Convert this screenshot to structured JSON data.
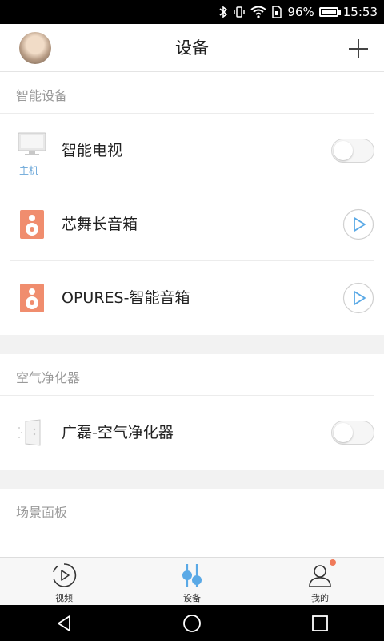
{
  "status_bar": {
    "battery": "96%",
    "time": "15:53"
  },
  "header": {
    "title": "设备"
  },
  "sections": [
    {
      "title": "智能设备",
      "items": [
        {
          "label": "智能电视",
          "sub": "主机",
          "control": "toggle",
          "on": false
        },
        {
          "label": "芯舞长音箱",
          "control": "play"
        },
        {
          "label": "OPURES-智能音箱",
          "control": "play"
        }
      ]
    },
    {
      "title": "空气净化器",
      "items": [
        {
          "label": "广磊-空气净化器",
          "control": "toggle",
          "on": false
        }
      ]
    },
    {
      "title": "场景面板",
      "items": []
    }
  ],
  "bottom_nav": [
    {
      "label": "视频",
      "icon": "video-play-icon"
    },
    {
      "label": "设备",
      "icon": "device-slider-icon",
      "active": true
    },
    {
      "label": "我的",
      "icon": "user-icon",
      "badge": true
    }
  ],
  "colors": {
    "accent": "#5aa9e6",
    "speaker": "#f08d6e",
    "badge": "#f07a5a"
  }
}
